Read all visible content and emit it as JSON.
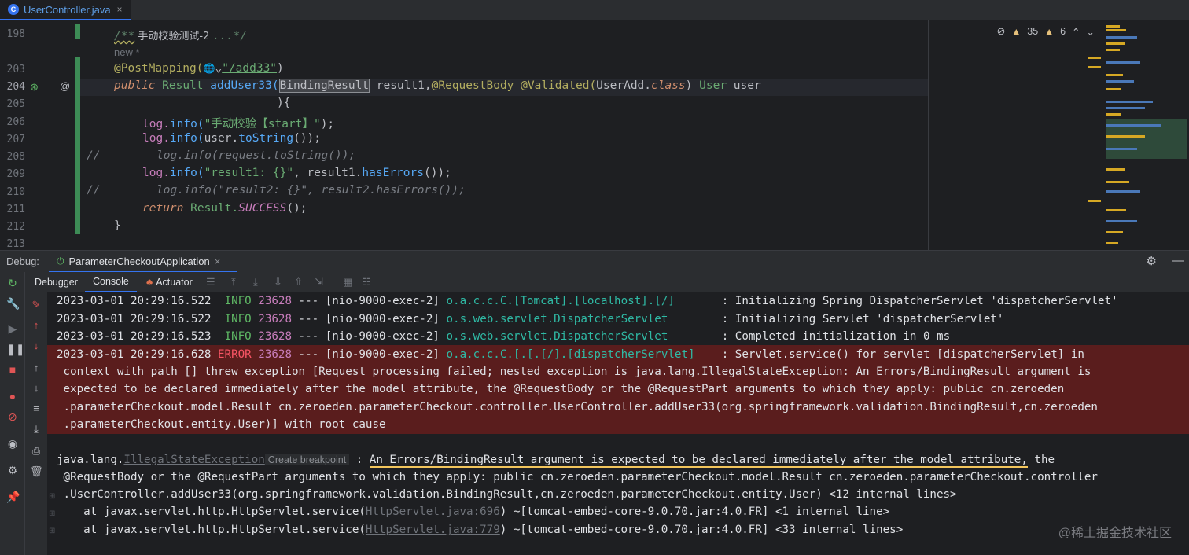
{
  "file_tab": {
    "label": "UserController.java",
    "icon": "java-class-icon",
    "close": "×"
  },
  "editor": {
    "line_numbers": [
      "198",
      "203",
      "204",
      "205",
      "206",
      "207",
      "208",
      "209",
      "210",
      "211",
      "212",
      "213"
    ],
    "doc_comment_prefix": "/**",
    "doc_comment_text": " 手动校验测试-2 ",
    "doc_comment_suffix": "...*/",
    "author_hint": "new *",
    "annotation": "@PostMapping(",
    "url_icon": "🌐",
    "url_chevron": "⌄",
    "url": "\"/add33\"",
    "close_paren": ")",
    "gutter_at": "@",
    "decl_public": "public",
    "decl_type": "Result",
    "decl_method": "addUser33(",
    "decl_param_type": "BindingResult",
    "decl_param_name": " result1,",
    "decl_ann1": "@RequestBody",
    "decl_ann2": "@Validated(",
    "decl_useradd": "UserAdd.",
    "decl_class_kw": "class",
    "decl_close": ") ",
    "decl_user_type": "User",
    "decl_user_name": " user",
    "brace_line": "){",
    "l205_a": "log.",
    "l205_b": "info(",
    "l205_c": "\"手动校验【start】\"",
    "l205_d": ");",
    "l206_a": "log.",
    "l206_b": "info(",
    "l206_c": "user.",
    "l206_d": "toString",
    "l206_e": "());",
    "l207_slashes": "//",
    "l207_text": "log.info(request.toString());",
    "l208_a": "log.",
    "l208_b": "info(",
    "l208_c": "\"result1: {}\"",
    "l208_d": ", result1.",
    "l208_e": "hasErrors",
    "l208_f": "());",
    "l209_slashes": "//",
    "l209_text": "log.info(\"result2: {}\", result2.hasErrors());",
    "l210_kw": "return",
    "l210_b": " Result.",
    "l210_c": "SUCCESS",
    "l210_d": "();",
    "l211": "}"
  },
  "inspections": {
    "hide_icon": "eye-off-icon",
    "warning_count": "35",
    "weak_warning_count": "6",
    "up": "⌃",
    "down": "⌄"
  },
  "debug_bar": {
    "label": "Debug:",
    "run_config": "ParameterCheckoutApplication",
    "close": "×",
    "settings_icon": "⚙",
    "minimize_icon": "—"
  },
  "subtabs": {
    "debugger": "Debugger",
    "console": "Console",
    "actuator": "Actuator"
  },
  "console": {
    "lines": [
      {
        "ts": "2023-03-01 20:29:16.522",
        "level": "INFO",
        "pid": "23628",
        "sep": "---",
        "thread": "[nio-9000-exec-2]",
        "logger": "o.a.c.c.C.[Tomcat].[localhost].[/]",
        "msg": ": Initializing Spring DispatcherServlet 'dispatcherServlet'"
      },
      {
        "ts": "2023-03-01 20:29:16.522",
        "level": "INFO",
        "pid": "23628",
        "sep": "---",
        "thread": "[nio-9000-exec-2]",
        "logger": "o.s.web.servlet.DispatcherServlet",
        "msg": ": Initializing Servlet 'dispatcherServlet'"
      },
      {
        "ts": "2023-03-01 20:29:16.523",
        "level": "INFO",
        "pid": "23628",
        "sep": "---",
        "thread": "[nio-9000-exec-2]",
        "logger": "o.s.web.servlet.DispatcherServlet",
        "msg": ": Completed initialization in 0 ms"
      },
      {
        "ts": "2023-03-01 20:29:16.628",
        "level": "ERROR",
        "pid": "23628",
        "sep": "---",
        "thread": "[nio-9000-exec-2]",
        "logger": "o.a.c.c.C.[.[.[/].[dispatcherServlet]",
        "msg": ": Servlet.service() for servlet [dispatcherServlet] in"
      }
    ],
    "error_cont": [
      " context with path [] threw exception [Request processing failed; nested exception is java.lang.IllegalStateException: An Errors/BindingResult argument is",
      " expected to be declared immediately after the model attribute, the @RequestBody or the @RequestPart arguments to which they apply: public cn.zeroeden",
      " .parameterCheckout.model.Result cn.zeroeden.parameterCheckout.controller.UserController.addUser33(org.springframework.validation.BindingResult,cn.zeroeden",
      " .parameterCheckout.entity.User)] with root cause"
    ],
    "exc_prefix": "java.lang.",
    "exc_name": "IllegalStateException",
    "create_breakpoint": "Create breakpoint",
    "exc_colon": " : ",
    "exc_msg_underlined": "An Errors/BindingResult argument is expected to be declared immediately after the model attribute,",
    "exc_msg_rest": " the",
    "exc_cont1": " @RequestBody or the @RequestPart arguments to which they apply: public cn.zeroeden.parameterCheckout.model.Result cn.zeroeden.parameterCheckout.controller",
    "exc_cont2": " .UserController.addUser33(org.springframework.validation.BindingResult,cn.zeroeden.parameterCheckout.entity.User) <12 internal lines>",
    "at1_prefix": "    at javax.servlet.http.HttpServlet.service(",
    "at1_link": "HttpServlet.java:696",
    "at1_suffix": ") ~[tomcat-embed-core-9.0.70.jar:4.0.FR] <1 internal line>",
    "at2_prefix": "    at javax.servlet.http.HttpServlet.service(",
    "at2_link": "HttpServlet.java:779",
    "at2_suffix": ") ~[tomcat-embed-core-9.0.70.jar:4.0.FR] <33 internal lines>"
  },
  "watermark": "@稀土掘金技术社区",
  "colors": {
    "background": "#1e1f22",
    "panel": "#2b2d30",
    "accent": "#3574f0",
    "error_bg": "#5a1d1d",
    "info": "#5fb865",
    "error": "#f75464",
    "logger": "#2fbaa5",
    "underline": "#f2c55c"
  }
}
